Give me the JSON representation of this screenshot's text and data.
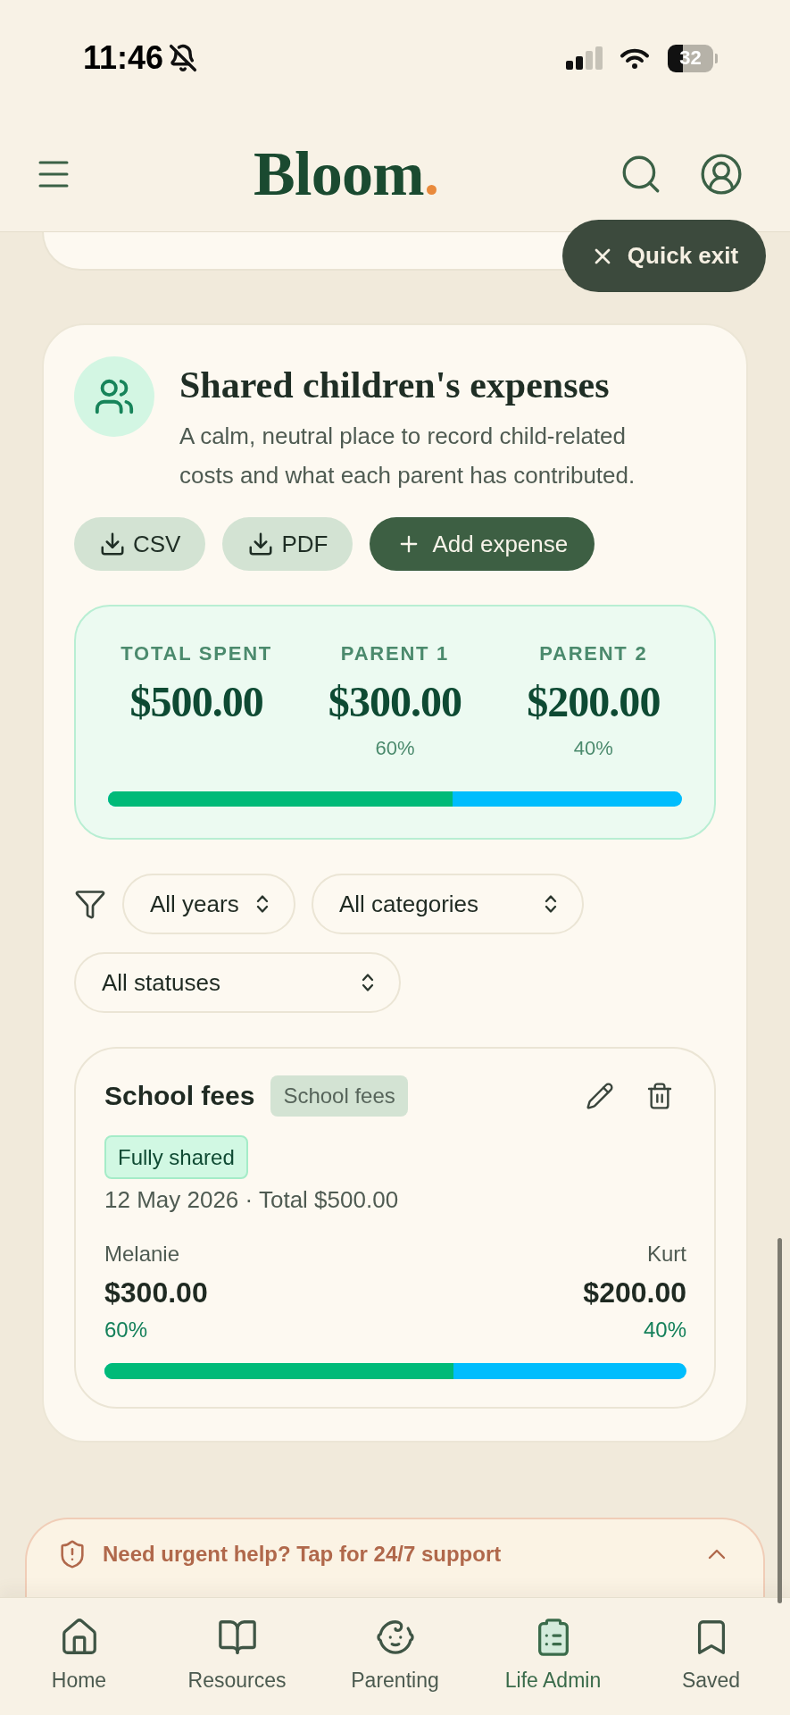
{
  "status_bar": {
    "time": "11:46",
    "battery": "32"
  },
  "header": {
    "logo": "Bloom",
    "quick_exit": "Quick exit"
  },
  "expenses": {
    "title": "Shared children's expenses",
    "description": "A calm, neutral place to record child-related costs and what each parent has contributed.",
    "actions": [
      {
        "kind": "export",
        "label": "CSV"
      },
      {
        "kind": "export",
        "label": "PDF"
      },
      {
        "kind": "add",
        "label": "Add expense"
      }
    ],
    "summary": {
      "columns": [
        {
          "label": "TOTAL SPENT",
          "amount": "$500.00"
        },
        {
          "label": "PARENT 1",
          "amount": "$300.00",
          "share": "60%"
        },
        {
          "label": "PARENT 2",
          "amount": "$200.00",
          "share": "40%"
        }
      ],
      "level": 0.6
    },
    "filters": [
      {
        "value": "All years"
      },
      {
        "value": "All categories"
      },
      {
        "value": "All statuses"
      }
    ],
    "items": [
      {
        "title": "School fees",
        "category": "School fees",
        "status": "Fully shared",
        "details": "12 May 2026 · Total $500.00",
        "parents": [
          {
            "name": "Melanie",
            "amount": "$300.00",
            "share": "60%"
          },
          {
            "name": "Kurt",
            "amount": "$200.00",
            "share": "40%"
          }
        ],
        "level": 0.6
      }
    ]
  },
  "help_banner": {
    "text": "Need urgent help? Tap for 24/7 support"
  },
  "nav": [
    {
      "label": "Home",
      "selected": false
    },
    {
      "label": "Resources",
      "selected": false
    },
    {
      "label": "Parenting",
      "selected": false
    },
    {
      "label": "Life Admin",
      "selected": true
    },
    {
      "label": "Saved",
      "selected": false
    }
  ]
}
